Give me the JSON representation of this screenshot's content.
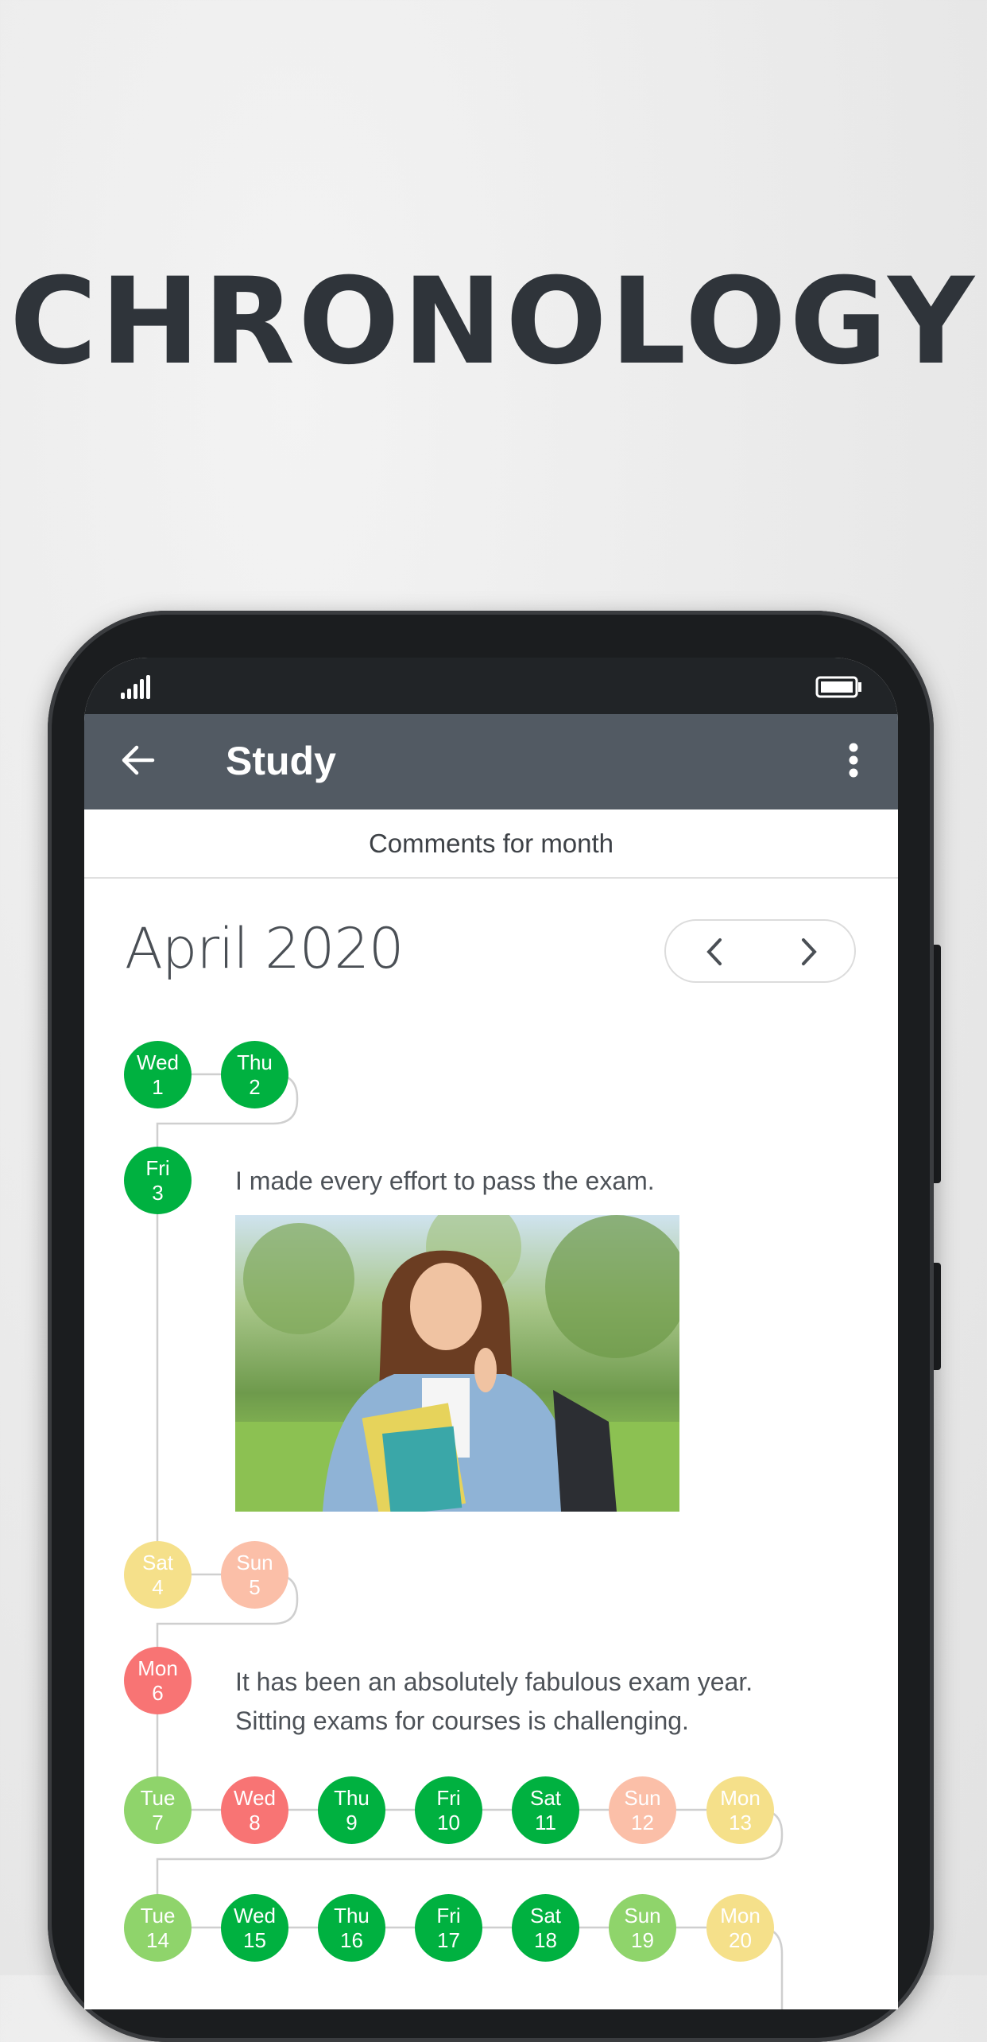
{
  "headline": "CHRONOLOGY",
  "app_bar": {
    "title": "Study",
    "back_icon": "arrow-left-icon",
    "menu_icon": "more-vertical-icon"
  },
  "status_bar": {
    "signal_icon": "signal-icon",
    "battery_icon": "battery-icon"
  },
  "subheader": "Comments for month",
  "month_label": "April 2020",
  "nav": {
    "prev_icon": "chevron-left-icon",
    "next_icon": "chevron-right-icon"
  },
  "colors": {
    "dark_green": "#00b140",
    "light_green": "#8fd46b",
    "yellow": "#f5e08a",
    "salmon": "#fbbfa8",
    "red": "#f87474",
    "appbar": "#525a63"
  },
  "days": [
    {
      "dow": "Wed",
      "num": "1",
      "color": "dark_green"
    },
    {
      "dow": "Thu",
      "num": "2",
      "color": "dark_green"
    },
    {
      "dow": "Fri",
      "num": "3",
      "color": "dark_green"
    },
    {
      "dow": "Sat",
      "num": "4",
      "color": "yellow"
    },
    {
      "dow": "Sun",
      "num": "5",
      "color": "salmon"
    },
    {
      "dow": "Mon",
      "num": "6",
      "color": "red"
    },
    {
      "dow": "Tue",
      "num": "7",
      "color": "light_green"
    },
    {
      "dow": "Wed",
      "num": "8",
      "color": "red"
    },
    {
      "dow": "Thu",
      "num": "9",
      "color": "dark_green"
    },
    {
      "dow": "Fri",
      "num": "10",
      "color": "dark_green"
    },
    {
      "dow": "Sat",
      "num": "11",
      "color": "dark_green"
    },
    {
      "dow": "Sun",
      "num": "12",
      "color": "salmon"
    },
    {
      "dow": "Mon",
      "num": "13",
      "color": "yellow"
    },
    {
      "dow": "Tue",
      "num": "14",
      "color": "light_green"
    },
    {
      "dow": "Wed",
      "num": "15",
      "color": "dark_green"
    },
    {
      "dow": "Thu",
      "num": "16",
      "color": "dark_green"
    },
    {
      "dow": "Fri",
      "num": "17",
      "color": "dark_green"
    },
    {
      "dow": "Sat",
      "num": "18",
      "color": "dark_green"
    },
    {
      "dow": "Sun",
      "num": "19",
      "color": "light_green"
    },
    {
      "dow": "Mon",
      "num": "20",
      "color": "yellow"
    }
  ],
  "comments": [
    {
      "day": "3",
      "lines": [
        "I made every effort to pass the exam."
      ],
      "has_photo": true
    },
    {
      "day": "6",
      "lines": [
        "It has been an absolutely fabulous exam year.",
        "Sitting exams for courses is challenging."
      ]
    }
  ]
}
